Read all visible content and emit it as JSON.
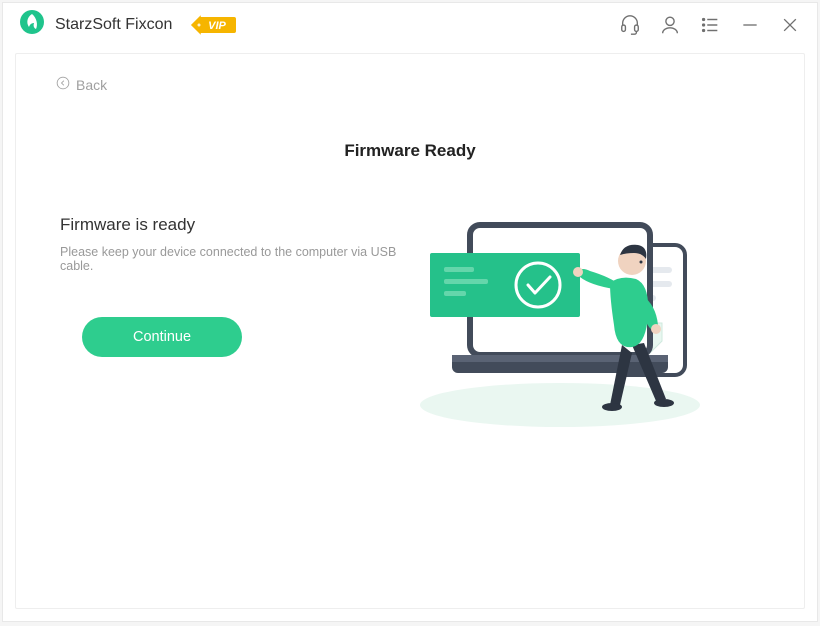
{
  "app": {
    "title": "StarzSoft Fixcon",
    "vip_label": "VIP"
  },
  "nav": {
    "back_label": "Back"
  },
  "page": {
    "title": "Firmware Ready",
    "subtitle": "Firmware is ready",
    "description": "Please keep your device connected to the computer via USB cable.",
    "continue_label": "Continue"
  },
  "colors": {
    "accent": "#2ecd8e",
    "vip_badge": "#f6b500"
  }
}
